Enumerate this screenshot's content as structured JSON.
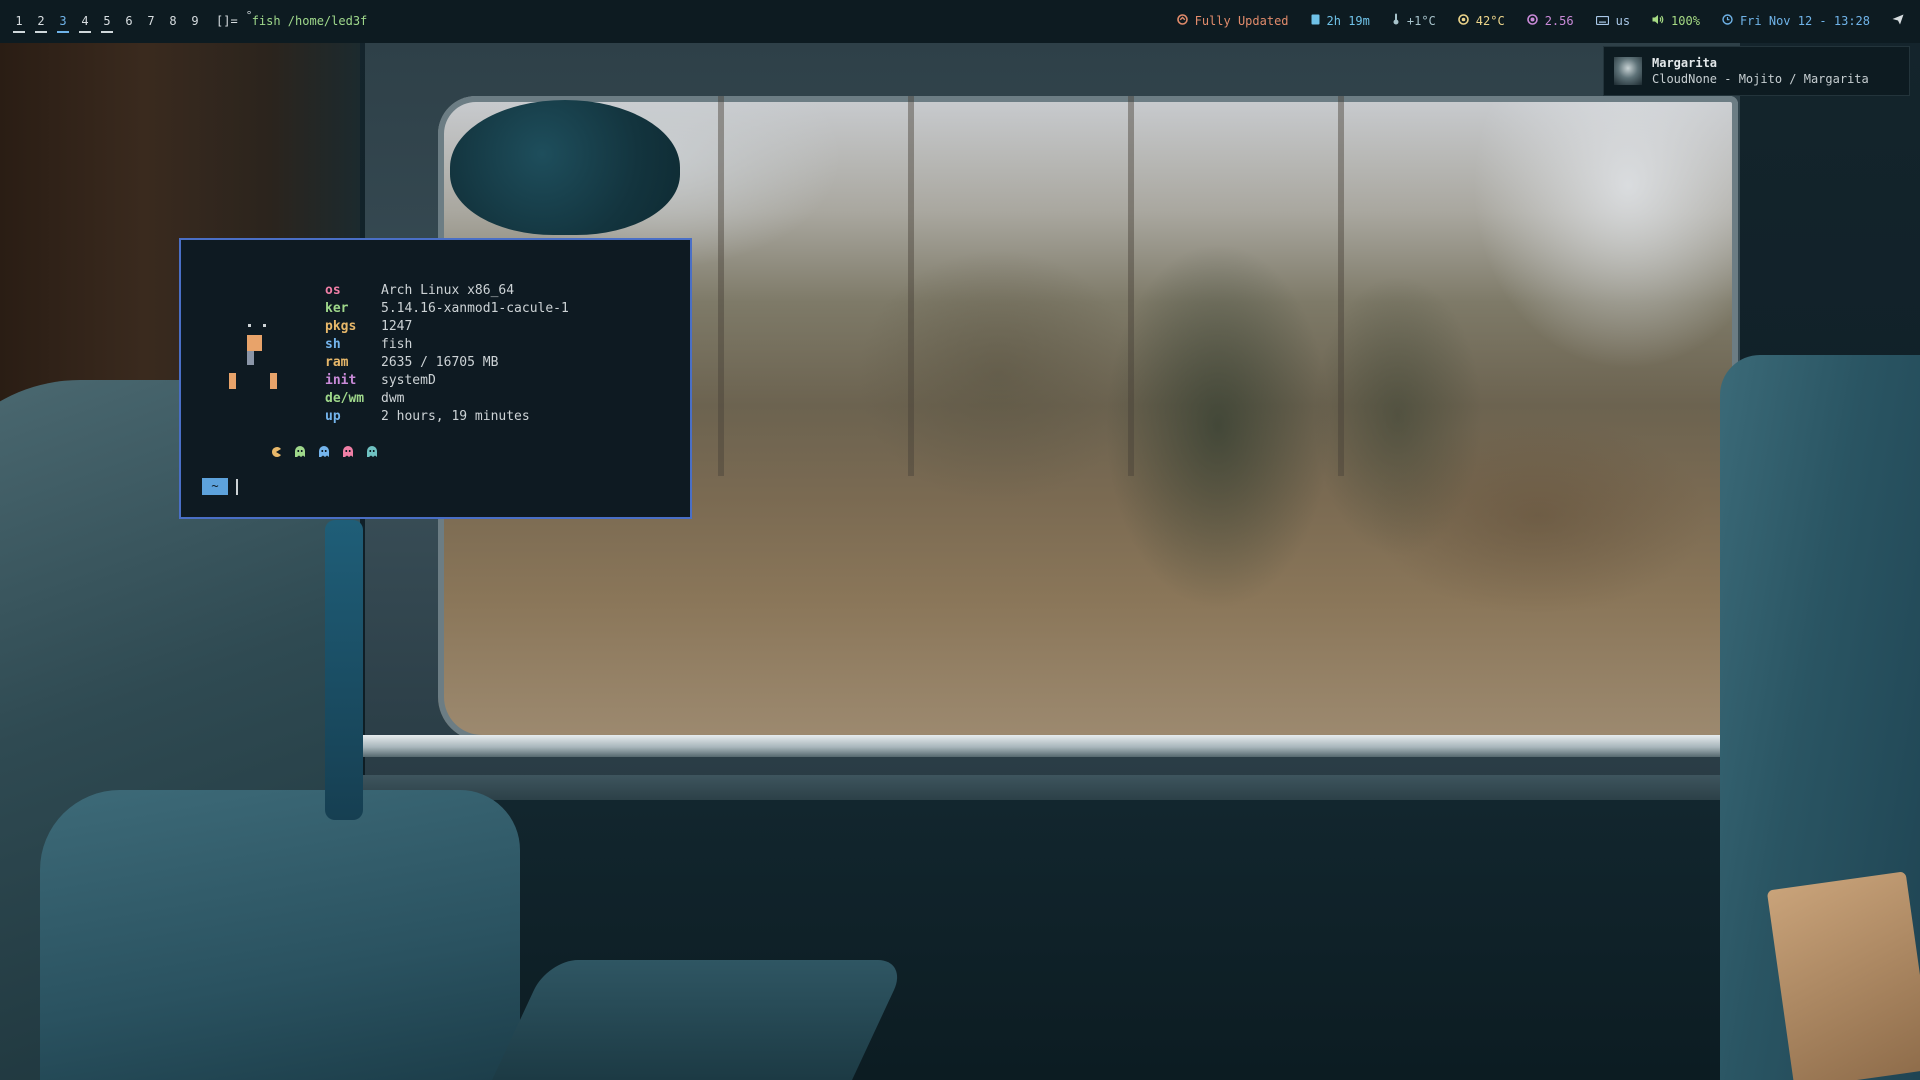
{
  "topbar": {
    "tags": [
      "1",
      "2",
      "3",
      "4",
      "5",
      "6",
      "7",
      "8",
      "9"
    ],
    "active_tag": "3",
    "layout_symbol": "[]=",
    "window_title": "fish /home/led3f",
    "modules": {
      "updates": {
        "icon": "package-icon",
        "text": "Fully Updated"
      },
      "uptime": {
        "icon": "clock-book-icon",
        "text": "2h 19m"
      },
      "weather": {
        "icon": "thermometer-icon",
        "text": "+1°C"
      },
      "temp": {
        "icon": "cpu-temp-icon",
        "text": "42°C"
      },
      "load": {
        "icon": "load-icon",
        "text": "2.56"
      },
      "keyboard": {
        "icon": "keyboard-icon",
        "text": "us"
      },
      "volume": {
        "icon": "volume-icon",
        "text": "100%"
      },
      "date": {
        "icon": "calendar-clock-icon",
        "text": "Fri Nov 12 - 13:28"
      },
      "send": {
        "icon": "paper-plane-icon"
      }
    }
  },
  "notification": {
    "title": "Margarita",
    "body": "CloudNone - Mojito / Margarita"
  },
  "terminal": {
    "info": [
      {
        "key": "os",
        "value": "Arch Linux x86_64"
      },
      {
        "key": "ker",
        "value": "5.14.16-xanmod1-cacule-1"
      },
      {
        "key": "pkgs",
        "value": "1247"
      },
      {
        "key": "sh",
        "value": "fish"
      },
      {
        "key": "ram",
        "value": "2635 / 16705 MB"
      },
      {
        "key": "init",
        "value": "systemD"
      },
      {
        "key": "de/wm",
        "value": "dwm"
      },
      {
        "key": "up",
        "value": "2 hours, 19 minutes"
      }
    ],
    "prompt_symbol": "~",
    "ghost_colors": [
      "#e8b86a",
      "#9fd88b",
      "#74b4ec",
      "#f07fa6",
      "#6fc2c2"
    ]
  },
  "colors": {
    "accent": "#4a6fc6",
    "bar_background": "#0d1b21",
    "terminal_background": "#0e1a22"
  }
}
